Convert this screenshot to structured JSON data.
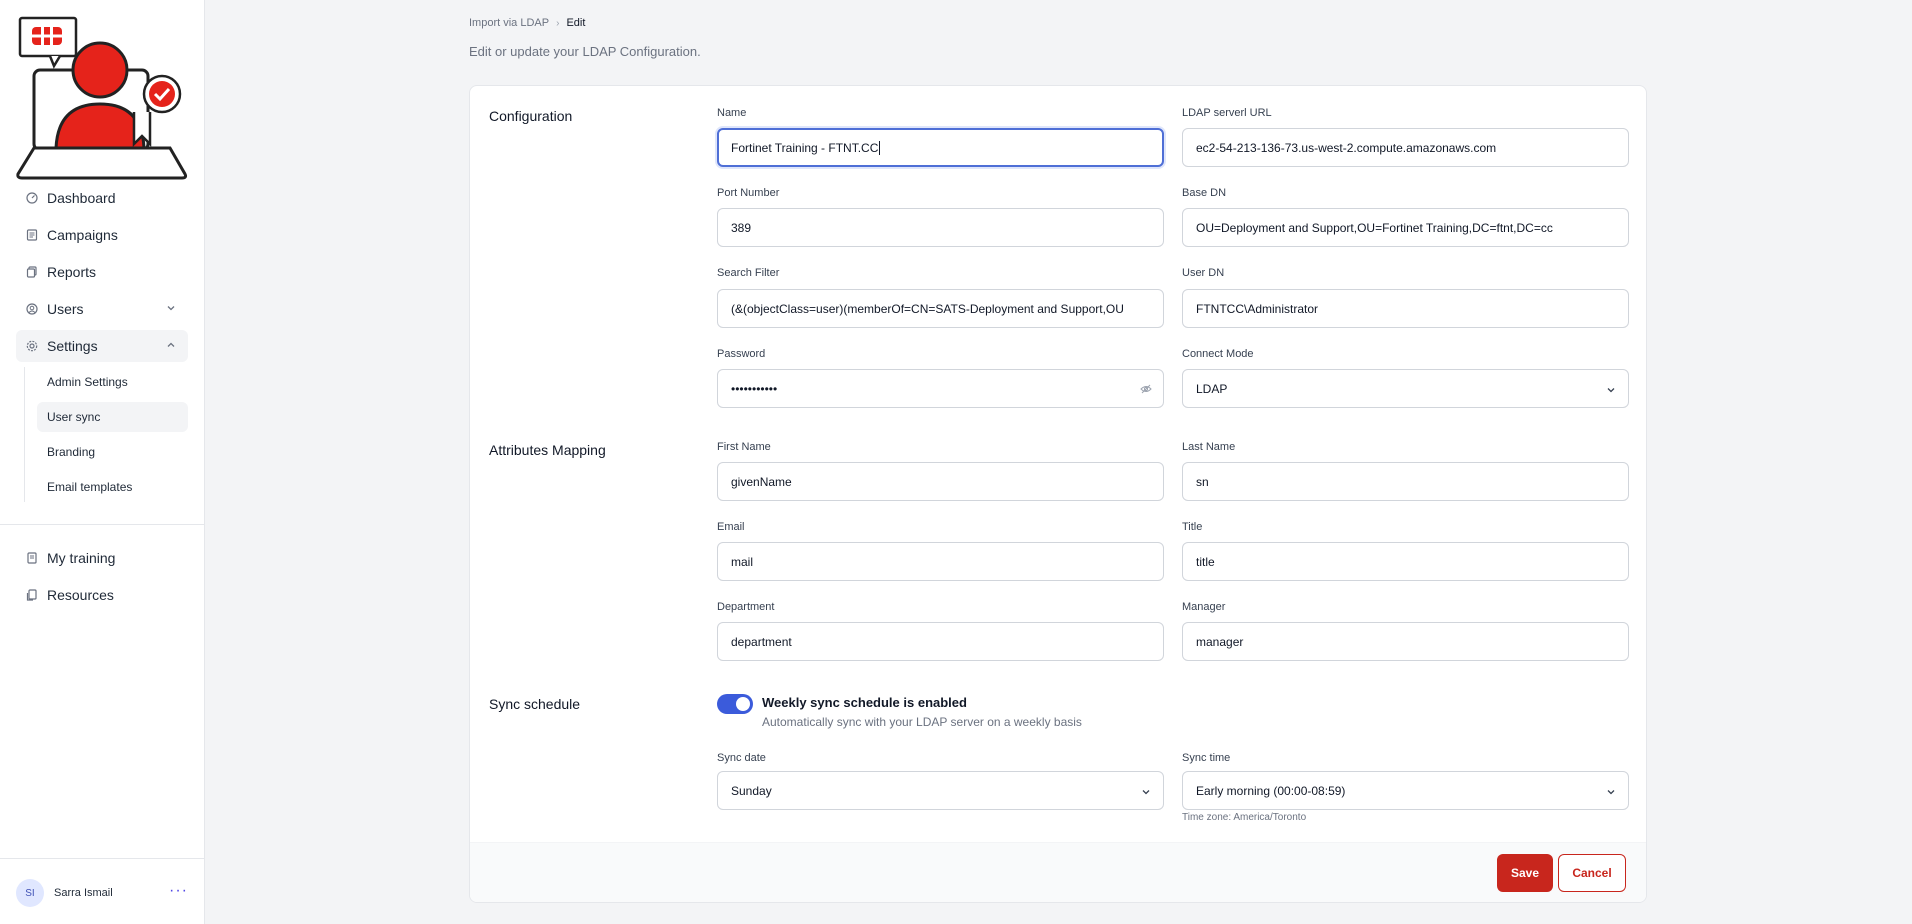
{
  "sidebar": {
    "nav": [
      {
        "label": "Dashboard",
        "icon": "dashboard-icon"
      },
      {
        "label": "Campaigns",
        "icon": "campaigns-icon"
      },
      {
        "label": "Reports",
        "icon": "reports-icon"
      },
      {
        "label": "Users",
        "icon": "users-icon"
      },
      {
        "label": "Settings",
        "icon": "gear-icon"
      }
    ],
    "settings_sub": [
      {
        "label": "Admin Settings"
      },
      {
        "label": "User sync"
      },
      {
        "label": "Branding"
      },
      {
        "label": "Email templates"
      }
    ],
    "nav2": [
      {
        "label": "My training",
        "icon": "training-icon"
      },
      {
        "label": "Resources",
        "icon": "resources-icon"
      }
    ],
    "user": {
      "initials": "SI",
      "name": "Sarra Ismail",
      "menu_icon": "more-icon"
    }
  },
  "breadcrumb": {
    "parent": "Import via LDAP",
    "current": "Edit"
  },
  "subtitle": "Edit or update your LDAP Configuration.",
  "sections": {
    "configuration": "Configuration",
    "attributes": "Attributes Mapping",
    "sync": "Sync schedule"
  },
  "config": {
    "name": {
      "label": "Name",
      "value": "Fortinet Training - FTNT.CC"
    },
    "ldap_url": {
      "label": "LDAP serverl URL",
      "value": "ec2-54-213-136-73.us-west-2.compute.amazonaws.com"
    },
    "port": {
      "label": "Port Number",
      "value": "389"
    },
    "base_dn": {
      "label": "Base DN",
      "value": "OU=Deployment and Support,OU=Fortinet Training,DC=ftnt,DC=cc"
    },
    "search_filter": {
      "label": "Search Filter",
      "value": "(&(objectClass=user)(memberOf=CN=SATS-Deployment and Support,OU"
    },
    "user_dn": {
      "label": "User DN",
      "value": "FTNTCC\\Administrator"
    },
    "password": {
      "label": "Password",
      "value": "•••••••••••"
    },
    "connect_mode": {
      "label": "Connect Mode",
      "value": "LDAP"
    }
  },
  "attributes": {
    "first_name": {
      "label": "First Name",
      "value": "givenName"
    },
    "last_name": {
      "label": "Last Name",
      "value": "sn"
    },
    "email": {
      "label": "Email",
      "value": "mail"
    },
    "title": {
      "label": "Title",
      "value": "title"
    },
    "department": {
      "label": "Department",
      "value": "department"
    },
    "manager": {
      "label": "Manager",
      "value": "manager"
    }
  },
  "sync": {
    "enabled": true,
    "toggle_title": "Weekly sync schedule is enabled",
    "toggle_desc": "Automatically sync with your LDAP server on a weekly basis",
    "sync_date": {
      "label": "Sync date",
      "value": "Sunday"
    },
    "sync_time": {
      "label": "Sync time",
      "value": "Early morning (00:00-08:59)"
    },
    "timezone": "Time zone: America/Toronto"
  },
  "actions": {
    "save": "Save",
    "cancel": "Cancel"
  },
  "colors": {
    "brand_red": "#c8261d",
    "accent_blue": "#3b5bdb"
  }
}
